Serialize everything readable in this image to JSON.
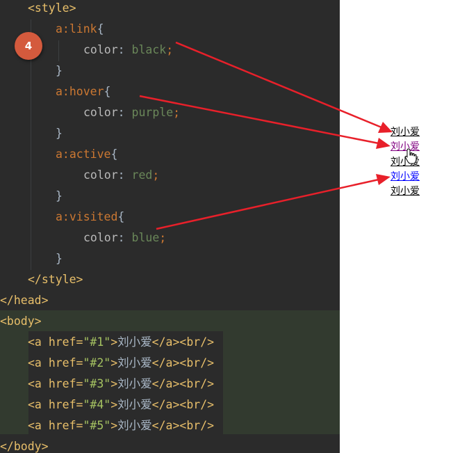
{
  "badge": {
    "number": "4"
  },
  "code": {
    "style_open": "<style>",
    "style_close": "</style>",
    "head_close": "</head>",
    "body_open": "<body>",
    "body_close": "</body>",
    "rules": [
      {
        "selector": "a:link",
        "property": "color",
        "value": "black"
      },
      {
        "selector": "a:hover",
        "property": "color",
        "value": "purple"
      },
      {
        "selector": "a:active",
        "property": "color",
        "value": "red"
      },
      {
        "selector": "a:visited",
        "property": "color",
        "value": "blue"
      }
    ],
    "anchors": [
      {
        "href": "#1",
        "text": "刘小爱"
      },
      {
        "href": "#2",
        "text": "刘小爱"
      },
      {
        "href": "#3",
        "text": "刘小爱"
      },
      {
        "href": "#4",
        "text": "刘小爱"
      },
      {
        "href": "#5",
        "text": "刘小爱"
      }
    ]
  },
  "preview": {
    "links": [
      {
        "text": "刘小爱",
        "state": "link",
        "color": "#000000"
      },
      {
        "text": "刘小爱",
        "state": "hover",
        "color": "#800080"
      },
      {
        "text": "刘小爱",
        "state": "link",
        "color": "#000000"
      },
      {
        "text": "刘小爱",
        "state": "visited",
        "color": "#0000ff"
      },
      {
        "text": "刘小爱",
        "state": "link",
        "color": "#000000"
      }
    ]
  },
  "colors": {
    "arrow": "#e8202a",
    "editor_bg": "#2b2b2b",
    "badge": "#d45a3d"
  }
}
